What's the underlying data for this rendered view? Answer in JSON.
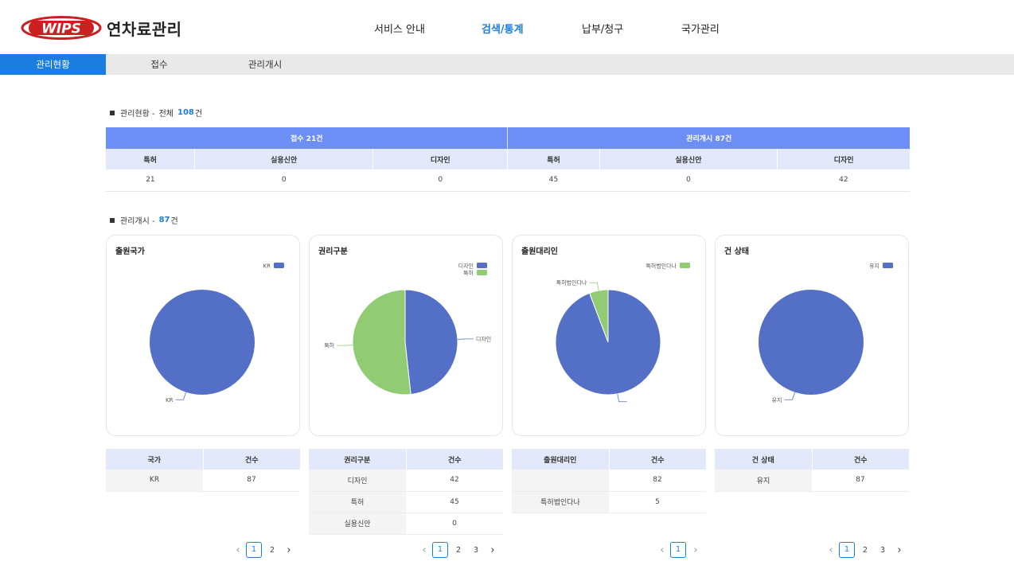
{
  "header": {
    "logo_mark": "WIPS",
    "app_title": "연차료관리",
    "nav": [
      "서비스 안내",
      "검색/통계",
      "납부/청구",
      "국가관리"
    ],
    "nav_active": 1
  },
  "subnav": {
    "items": [
      "관리현황",
      "접수",
      "관리개시"
    ],
    "active": 0
  },
  "summary": {
    "title": "관리현황 -",
    "total_label": "전체",
    "total_count": "108",
    "count_unit": "건",
    "groups": [
      "접수 21건",
      "관리개시 87건"
    ],
    "columns": [
      "특허",
      "실용신안",
      "디자인",
      "특허",
      "실용신안",
      "디자인"
    ],
    "values": [
      "21",
      "0",
      "0",
      "45",
      "0",
      "42"
    ]
  },
  "mgmt": {
    "title": "관리개시 -",
    "count": "87",
    "count_unit": "건"
  },
  "colors": {
    "accent": "#1a7de0",
    "header_blue": "#6d8ef5",
    "pie_blue": "#5470c6",
    "pie_green": "#91cc75"
  },
  "chart_data": [
    {
      "type": "pie",
      "title": "출원국가",
      "legend": "top-right",
      "categories": [
        "KR"
      ],
      "values": [
        87
      ],
      "colors": [
        "#5470c6"
      ],
      "labels": [
        "KR"
      ]
    },
    {
      "type": "pie",
      "title": "권리구분",
      "legend": "top-right",
      "categories": [
        "디자인",
        "특허"
      ],
      "values": [
        42,
        45
      ],
      "colors": [
        "#5470c6",
        "#91cc75"
      ],
      "labels": [
        "디자인",
        "특허"
      ]
    },
    {
      "type": "pie",
      "title": "출원대리인",
      "legend": "top-right",
      "categories": [
        "",
        "특허법인다나"
      ],
      "values": [
        82,
        5
      ],
      "colors": [
        "#5470c6",
        "#91cc75"
      ],
      "labels": [
        "",
        "특허법인다나"
      ],
      "legend_items": [
        "특허법인다나"
      ]
    },
    {
      "type": "pie",
      "title": "건 상태",
      "legend": "top-right",
      "categories": [
        "유지"
      ],
      "values": [
        87
      ],
      "colors": [
        "#5470c6"
      ],
      "labels": [
        "유지"
      ]
    }
  ],
  "tables": [
    {
      "headers": [
        "국가",
        "건수"
      ],
      "rows": [
        [
          "KR",
          "87"
        ]
      ]
    },
    {
      "headers": [
        "권리구분",
        "건수"
      ],
      "rows": [
        [
          "디자인",
          "42"
        ],
        [
          "특허",
          "45"
        ],
        [
          "실용신안",
          "0"
        ]
      ]
    },
    {
      "headers": [
        "출원대리인",
        "건수"
      ],
      "rows": [
        [
          "",
          "82"
        ],
        [
          "특허법인다나",
          "5"
        ]
      ]
    },
    {
      "headers": [
        "건 상태",
        "건수"
      ],
      "rows": [
        [
          "유지",
          "87"
        ]
      ]
    }
  ],
  "pagers": [
    {
      "pages": [
        "1",
        "2"
      ],
      "current": "1",
      "prev_enabled": false,
      "next_enabled": true,
      "prev_icon": "chevron-left-icon",
      "next_icon": "chevron-right-icon"
    },
    {
      "pages": [
        "1",
        "2",
        "3"
      ],
      "current": "1",
      "prev_enabled": false,
      "next_enabled": true,
      "prev_icon": "chevron-left-icon",
      "next_icon": "chevron-right-icon"
    },
    {
      "pages": [
        "1"
      ],
      "current": "1",
      "prev_enabled": false,
      "next_enabled": false,
      "prev_icon": "chevron-left-icon",
      "next_icon": "chevron-right-icon"
    },
    {
      "pages": [
        "1",
        "2",
        "3"
      ],
      "current": "1",
      "prev_enabled": false,
      "next_enabled": true,
      "prev_icon": "chevron-left-icon",
      "next_icon": "chevron-right-icon"
    }
  ]
}
